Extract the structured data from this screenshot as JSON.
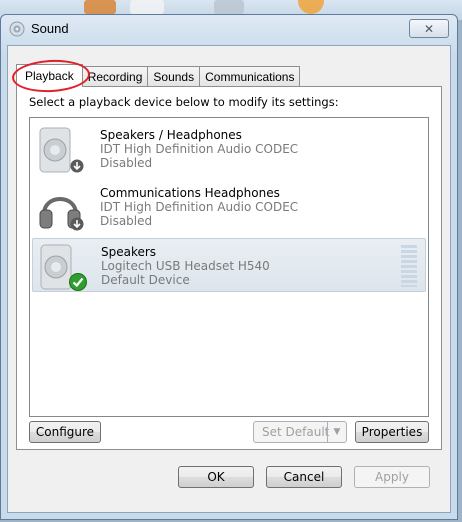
{
  "window": {
    "title": "Sound",
    "icon": "speaker-icon",
    "close_icon": "close-icon",
    "close_label": "✕"
  },
  "tabs": [
    {
      "label": "Playback",
      "active": true
    },
    {
      "label": "Recording",
      "active": false
    },
    {
      "label": "Sounds",
      "active": false
    },
    {
      "label": "Communications",
      "active": false
    }
  ],
  "instruction": "Select a playback device below to modify its settings:",
  "devices": [
    {
      "name": "Speakers / Headphones",
      "driver": "IDT High Definition Audio CODEC",
      "status": "Disabled",
      "icon": "speaker-icon",
      "badge": "disabled-arrow-icon",
      "selected": false
    },
    {
      "name": "Communications Headphones",
      "driver": "IDT High Definition Audio CODEC",
      "status": "Disabled",
      "icon": "headphones-icon",
      "badge": "disabled-arrow-icon",
      "selected": false
    },
    {
      "name": "Speakers",
      "driver": "Logitech USB Headset H540",
      "status": "Default Device",
      "icon": "speaker-icon",
      "badge": "default-check-icon",
      "selected": true
    }
  ],
  "buttons": {
    "configure": "Configure",
    "set_default": "Set Default",
    "properties": "Properties",
    "ok": "OK",
    "cancel": "Cancel",
    "apply": "Apply"
  },
  "colors": {
    "annotation": "#e0202a",
    "check": "#2e9e2e"
  }
}
